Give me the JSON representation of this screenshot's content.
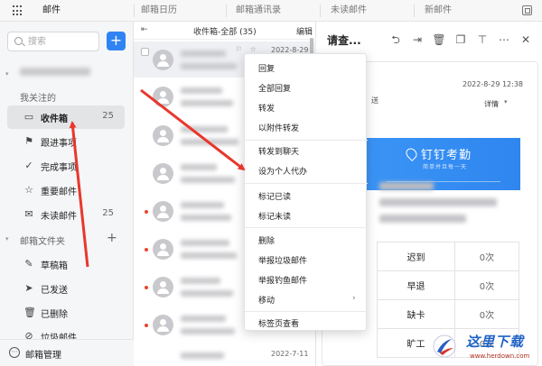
{
  "topbar": {
    "tabs": [
      "邮件",
      "邮箱日历",
      "邮箱通讯录",
      "未读邮件",
      "新邮件"
    ]
  },
  "sidebar": {
    "search_placeholder": "搜索",
    "compose_label": "+",
    "section_following": "我关注的",
    "items": [
      {
        "label": "收件箱",
        "count": "25",
        "icon": "inbox-icon",
        "glyph": "▭"
      },
      {
        "label": "跟进事项",
        "count": "",
        "icon": "flag-icon",
        "glyph": "⚑"
      },
      {
        "label": "完成事项",
        "count": "",
        "icon": "check-circle-icon",
        "glyph": "✓"
      },
      {
        "label": "重要邮件",
        "count": "",
        "icon": "star-icon",
        "glyph": "☆"
      },
      {
        "label": "未读邮件",
        "count": "25",
        "icon": "mail-icon",
        "glyph": "✉"
      }
    ],
    "section_folders": "邮箱文件夹",
    "folder_add": "+",
    "folders": [
      {
        "label": "草稿箱",
        "icon": "draft-icon",
        "glyph": "✎"
      },
      {
        "label": "已发送",
        "icon": "send-icon",
        "glyph": "➤"
      },
      {
        "label": "已删除",
        "icon": "trash-icon",
        "glyph": "🗑"
      },
      {
        "label": "垃圾邮件",
        "icon": "spam-icon",
        "glyph": "⊘"
      }
    ],
    "footer_label": "邮箱管理"
  },
  "maillist": {
    "title": "收件箱-全部 (35)",
    "edit_label": "编辑",
    "collapse_glyph": "⇤",
    "first_date": "2022-8-29",
    "last_date": "2022-7-11",
    "row_icons": "⚐ ☆"
  },
  "pane": {
    "subject": "请查...",
    "date": "2022-8-29 12:38",
    "detail_label": "详情",
    "sender_tail": "送",
    "toolbar_icons": [
      {
        "name": "reply-icon",
        "glyph": "⮌"
      },
      {
        "name": "forward-folder-icon",
        "glyph": "⇥"
      },
      {
        "name": "delete-icon",
        "glyph": "🗑"
      },
      {
        "name": "copy-icon",
        "glyph": "❐"
      },
      {
        "name": "pin-icon",
        "glyph": "⊤"
      },
      {
        "name": "more-icon",
        "glyph": "⋯"
      },
      {
        "name": "close-icon",
        "glyph": "✕"
      }
    ],
    "banner_title": "钉钉考勤",
    "banner_subtitle": "简单并且每一天",
    "stats": [
      {
        "label": "迟到",
        "value": "0次"
      },
      {
        "label": "早退",
        "value": "0次"
      },
      {
        "label": "缺卡",
        "value": "0次"
      },
      {
        "label": "旷工",
        "value": "0次"
      }
    ]
  },
  "context_menu": {
    "groups": [
      [
        "回复",
        "全部回复",
        "转发",
        "以附件转发"
      ],
      [
        "转发到聊天",
        "设为个人代办"
      ],
      [
        "标记已读",
        "标记未读"
      ],
      [
        "删除",
        "举报垃圾邮件",
        "举报钓鱼邮件",
        "移动"
      ],
      [
        "标签页查看"
      ]
    ],
    "submenu_arrow": "›"
  },
  "watermark": {
    "name": "这里下载",
    "url": "www.herdown.com"
  },
  "colors": {
    "accent": "#2f83f2",
    "arrow": "#e8372c",
    "banner": "#3a94f5"
  }
}
